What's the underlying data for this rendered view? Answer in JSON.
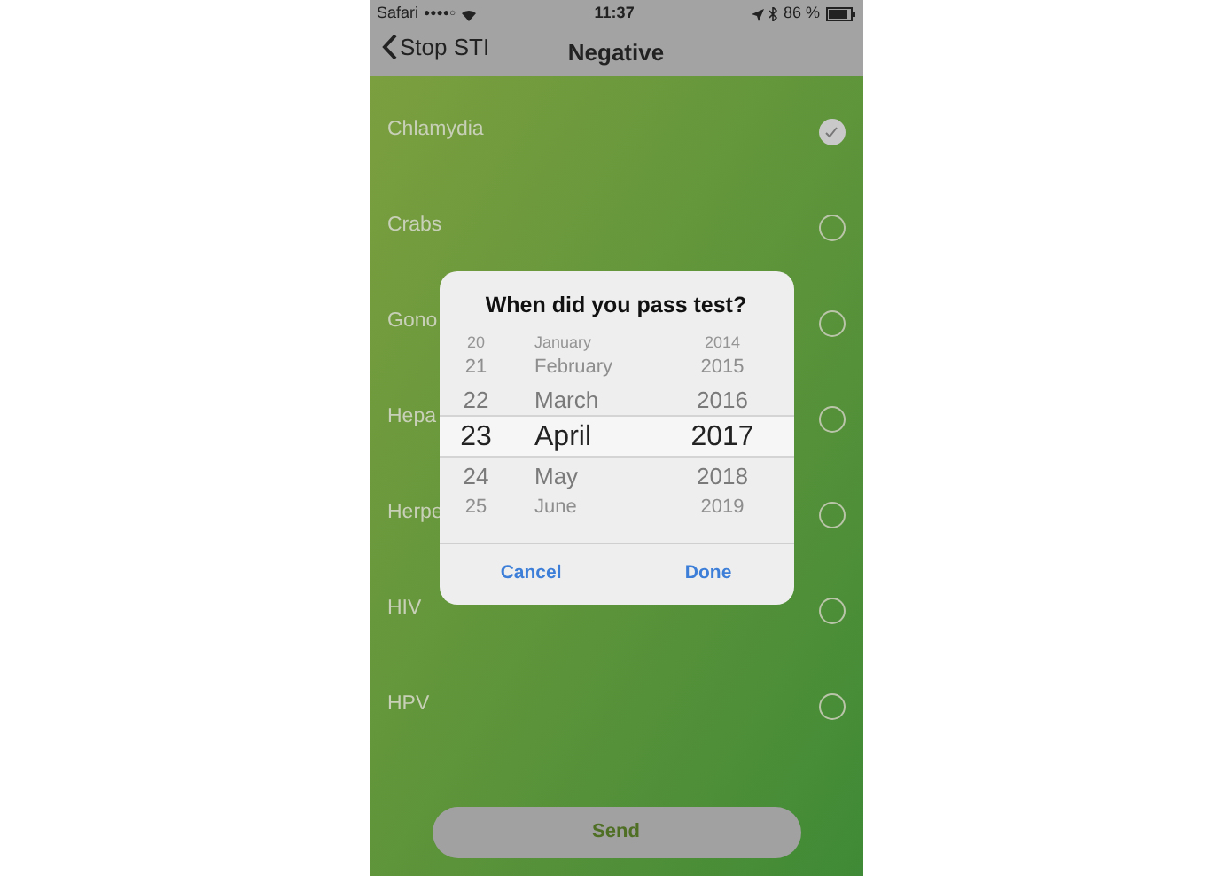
{
  "status_bar": {
    "carrier": "Safari",
    "signal": "●●●●○",
    "time": "11:37",
    "battery": "86 %"
  },
  "nav": {
    "back": "Stop STI",
    "title": "Negative"
  },
  "items": [
    {
      "label": "Chlamydia",
      "checked": true
    },
    {
      "label": "Crabs",
      "checked": false
    },
    {
      "label": "Gono",
      "checked": false
    },
    {
      "label": "Hepa",
      "checked": false
    },
    {
      "label": "Herpe",
      "checked": false
    },
    {
      "label": "HIV",
      "checked": false
    },
    {
      "label": "HPV",
      "checked": false
    }
  ],
  "dialog": {
    "title": "When did you pass test?",
    "picker_rows": [
      {
        "day": "20",
        "month": "January",
        "year": "2014",
        "selected": false
      },
      {
        "day": "21",
        "month": "February",
        "year": "2015",
        "selected": false
      },
      {
        "day": "22",
        "month": "March",
        "year": "2016",
        "selected": false
      },
      {
        "day": "23",
        "month": "April",
        "year": "2017",
        "selected": true
      },
      {
        "day": "24",
        "month": "May",
        "year": "2018",
        "selected": false
      },
      {
        "day": "25",
        "month": "June",
        "year": "2019",
        "selected": false
      }
    ],
    "buttons": [
      "Cancel",
      "Done"
    ]
  },
  "send_button": "Send"
}
